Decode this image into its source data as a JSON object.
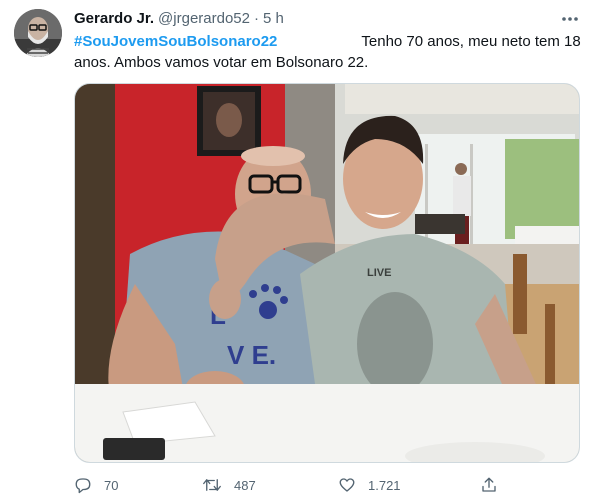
{
  "author": {
    "name": "Gerardo Jr.",
    "handle": "@jrgerardo52",
    "separator": "·",
    "time": "5 h"
  },
  "tweet": {
    "hashtag": "#SouJovemSouBolsonaro22",
    "text_line1": "Tenho 70 anos, meu neto tem 18",
    "text_line2": "anos. Ambos vamos votar em Bolsonaro 22."
  },
  "image": {
    "shirt_print": "LIVE"
  },
  "actions": {
    "replies": "70",
    "retweets": "487",
    "likes": "1.721"
  },
  "icons": [
    "more-icon",
    "reply-icon",
    "retweet-icon",
    "like-icon",
    "share-icon"
  ],
  "colors": {
    "link": "#1d9bf0",
    "text": "#0f1419",
    "secondary": "#536471",
    "border": "#cfd9de"
  }
}
